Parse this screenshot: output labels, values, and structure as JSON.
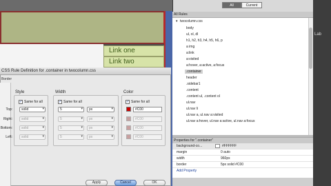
{
  "editor": {
    "links": [
      "Link one",
      "Link two"
    ]
  },
  "dialog": {
    "title": "CSS Rule Definition for .container in twocolumn.css",
    "category": "Border",
    "groups": {
      "style": "Style",
      "width": "Width",
      "color": "Color"
    },
    "same_for_all": "Same for all",
    "sides": [
      "Top:",
      "Right:",
      "Bottom:",
      "Left:"
    ],
    "style_values": [
      "solid",
      "solid",
      "solid",
      "solid"
    ],
    "width_values": [
      "5",
      "5",
      "5",
      "5"
    ],
    "unit_values": [
      "px",
      "px",
      "px",
      "px"
    ],
    "color_values": [
      "#C00",
      "#C00",
      "#C00",
      "#C00"
    ],
    "buttons": {
      "apply": "Apply",
      "cancel": "Cancel",
      "ok": "OK"
    }
  },
  "panel": {
    "seg_all": "All",
    "seg_current": "Current",
    "rules_title": "All Rules",
    "rules": [
      "twocolumn.css",
      "body",
      "ul, ol, dl",
      "h1, h2, h3, h4, h5, h6, p",
      "a img",
      "a:link",
      "a:visited",
      "a:hover, a:active, a:focus",
      ".container",
      "header",
      ".sidebar1",
      ".content",
      ".content ul, .content ol",
      "ul.nav",
      "ul.nav li",
      "ul.nav a, ul.nav a:visited",
      "ul.nav a:hover, ul.nav a:active, ul.nav a:focus"
    ],
    "selected_rule": ".container",
    "props_title": "Properties for \".container\"",
    "properties": [
      {
        "name": "background-co...",
        "value": "#FFFFFF"
      },
      {
        "name": "margin",
        "value": "0 auto"
      },
      {
        "name": "width",
        "value": "960px"
      },
      {
        "name": "border",
        "value": "5px solid #C00"
      }
    ],
    "add_property": "Add Property",
    "side_label": "Lab"
  },
  "colors": {
    "accent_red": "#CC0000",
    "header_green": "#AEB585",
    "link_green": "#D7E3A8"
  }
}
